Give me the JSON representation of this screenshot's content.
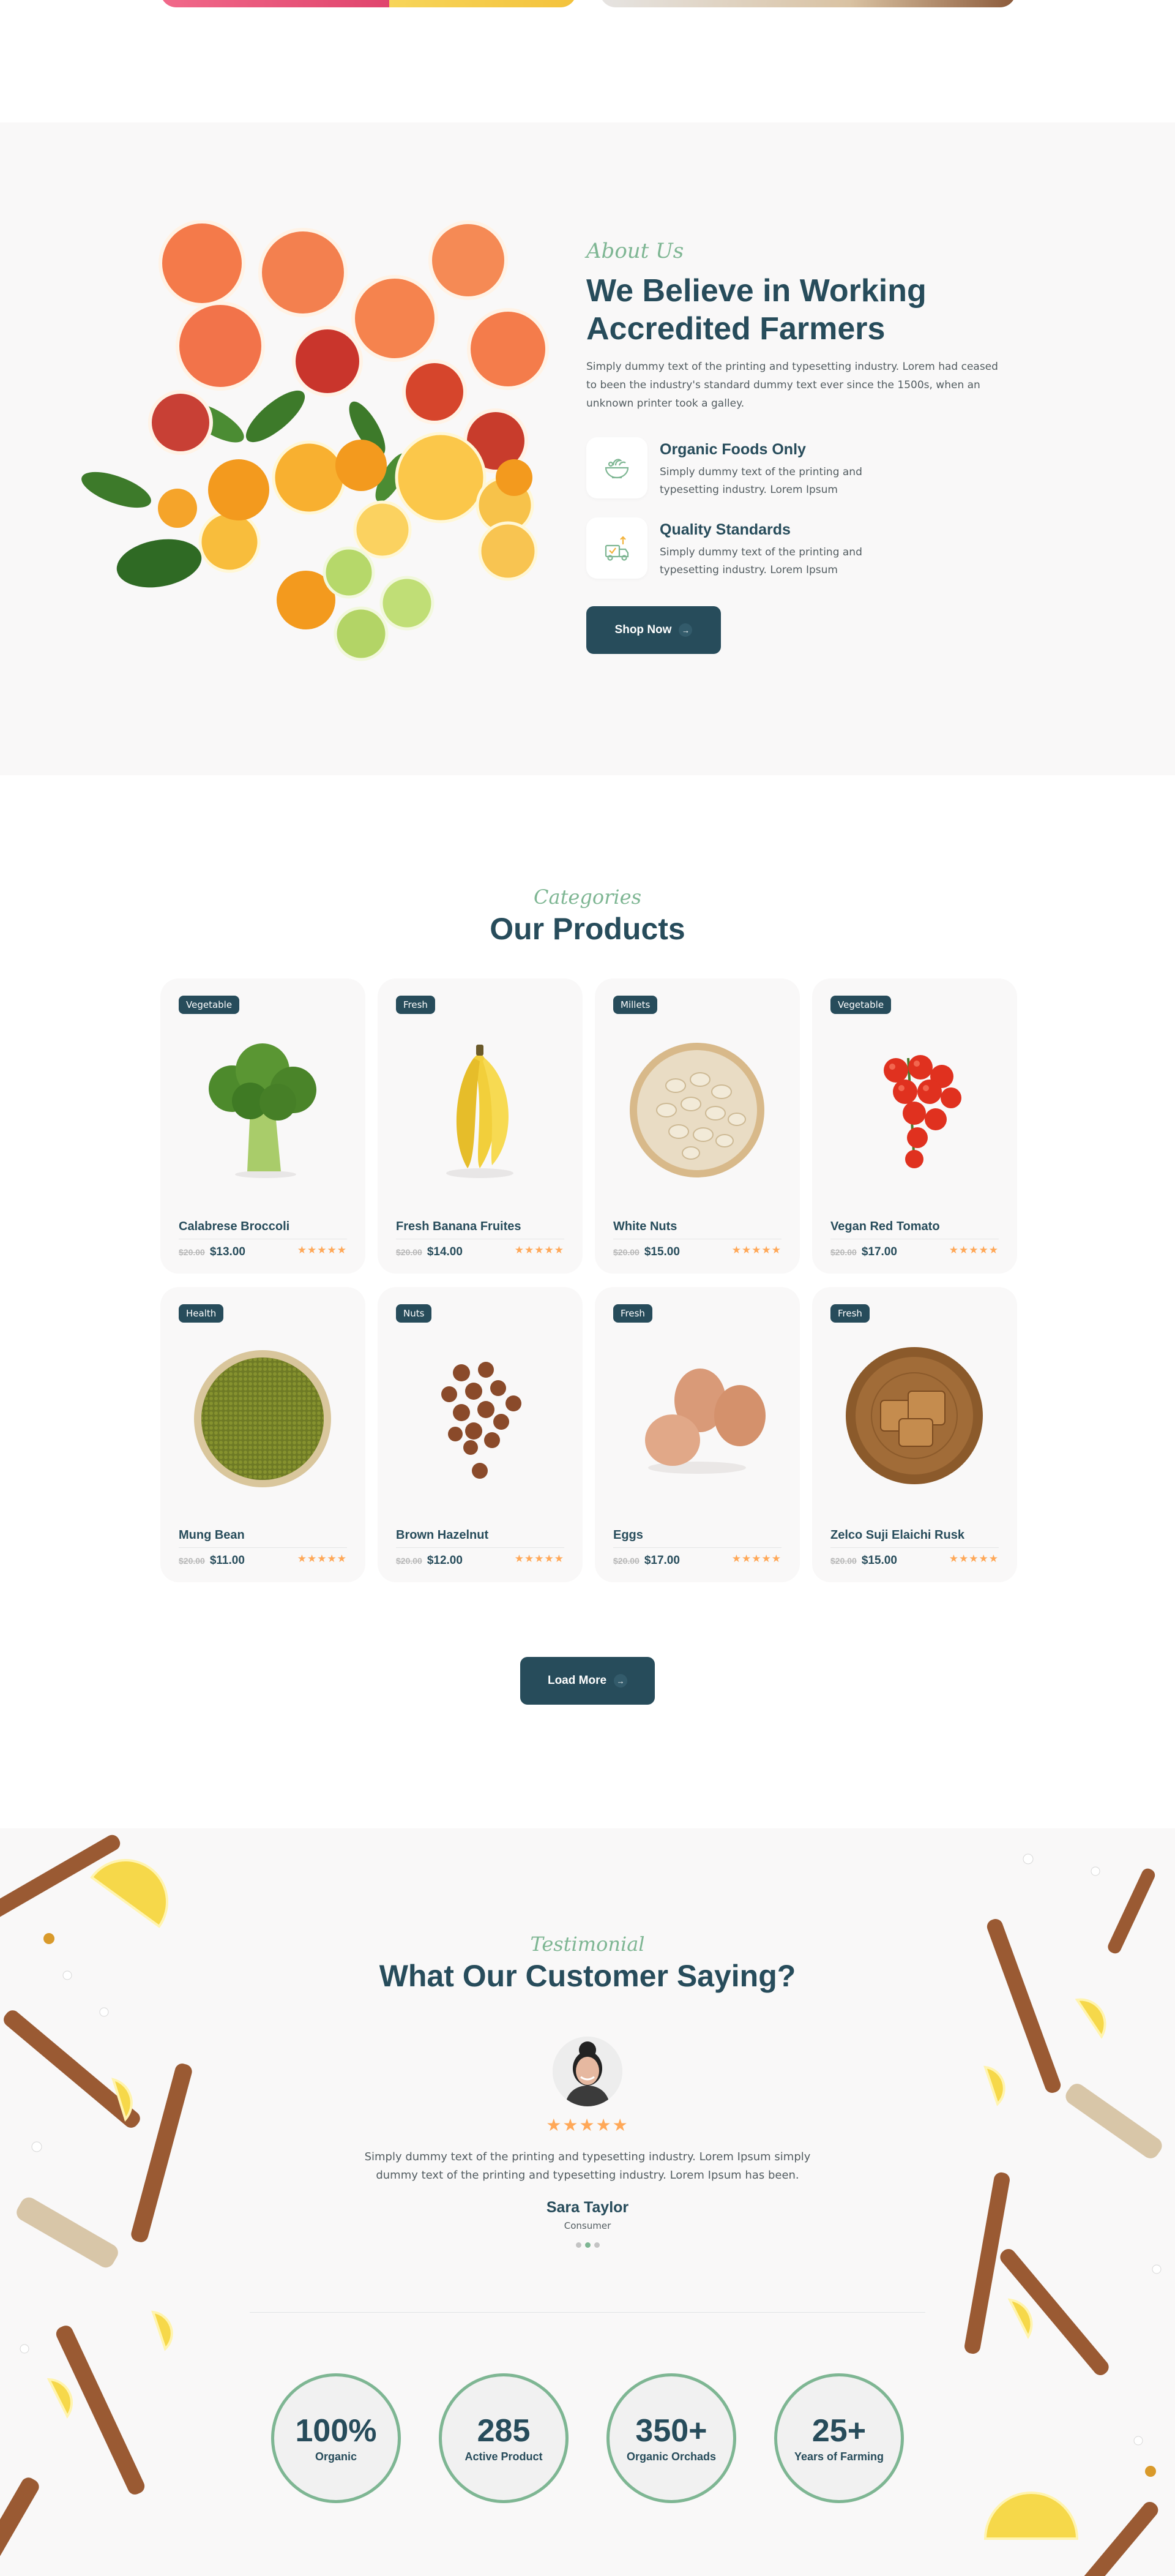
{
  "colors": {
    "primary": "#274c5b",
    "accent_green": "#7eb693",
    "star": "#ffa858",
    "section_bg": "#f9f8f8"
  },
  "about": {
    "script_label": "About Us",
    "title_line1": "We Believe in Working",
    "title_line2": "Accredited Farmers",
    "description": "Simply dummy text of the printing and typesetting industry. Lorem had ceased to been the industry's standard dummy text ever since the 1500s, when an unknown printer took a galley.",
    "features": [
      {
        "icon": "organic-bowl-icon",
        "title": "Organic Foods Only",
        "text": "Simply dummy text of the printing and typesetting industry. Lorem Ipsum"
      },
      {
        "icon": "quality-standards-icon",
        "title": "Quality Standards",
        "text": "Simply dummy text of the printing and typesetting industry. Lorem Ipsum"
      }
    ],
    "button_label": "Shop Now"
  },
  "products": {
    "script_label": "Categories",
    "title": "Our Products",
    "items": [
      {
        "tag": "Vegetable",
        "name": "Calabrese Broccoli",
        "old_price": "$20.00",
        "price": "$13.00",
        "rating": 5
      },
      {
        "tag": "Fresh",
        "name": "Fresh Banana Fruites",
        "old_price": "$20.00",
        "price": "$14.00",
        "rating": 5
      },
      {
        "tag": "Millets",
        "name": "White Nuts",
        "old_price": "$20.00",
        "price": "$15.00",
        "rating": 5
      },
      {
        "tag": "Vegetable",
        "name": "Vegan Red Tomato",
        "old_price": "$20.00",
        "price": "$17.00",
        "rating": 5
      },
      {
        "tag": "Health",
        "name": "Mung Bean",
        "old_price": "$20.00",
        "price": "$11.00",
        "rating": 5
      },
      {
        "tag": "Nuts",
        "name": "Brown Hazelnut",
        "old_price": "$20.00",
        "price": "$12.00",
        "rating": 5
      },
      {
        "tag": "Fresh",
        "name": "Eggs",
        "old_price": "$20.00",
        "price": "$17.00",
        "rating": 5
      },
      {
        "tag": "Fresh",
        "name": "Zelco Suji Elaichi Rusk",
        "old_price": "$20.00",
        "price": "$15.00",
        "rating": 5
      }
    ],
    "load_more_label": "Load More"
  },
  "testimonial": {
    "script_label": "Testimonial",
    "title": "What Our Customer Saying?",
    "rating": 5,
    "quote": "Simply dummy text of the printing and typesetting industry. Lorem Ipsum simply dummy text of the printing and typesetting industry. Lorem Ipsum has been.",
    "name": "Sara Taylor",
    "role": "Consumer",
    "slides": 3,
    "active_slide": 1,
    "stats": [
      {
        "value": "100%",
        "label": "Organic"
      },
      {
        "value": "285",
        "label": "Active Product"
      },
      {
        "value": "350+",
        "label": "Organic Orchads"
      },
      {
        "value": "25+",
        "label": "Years of Farming"
      }
    ]
  }
}
